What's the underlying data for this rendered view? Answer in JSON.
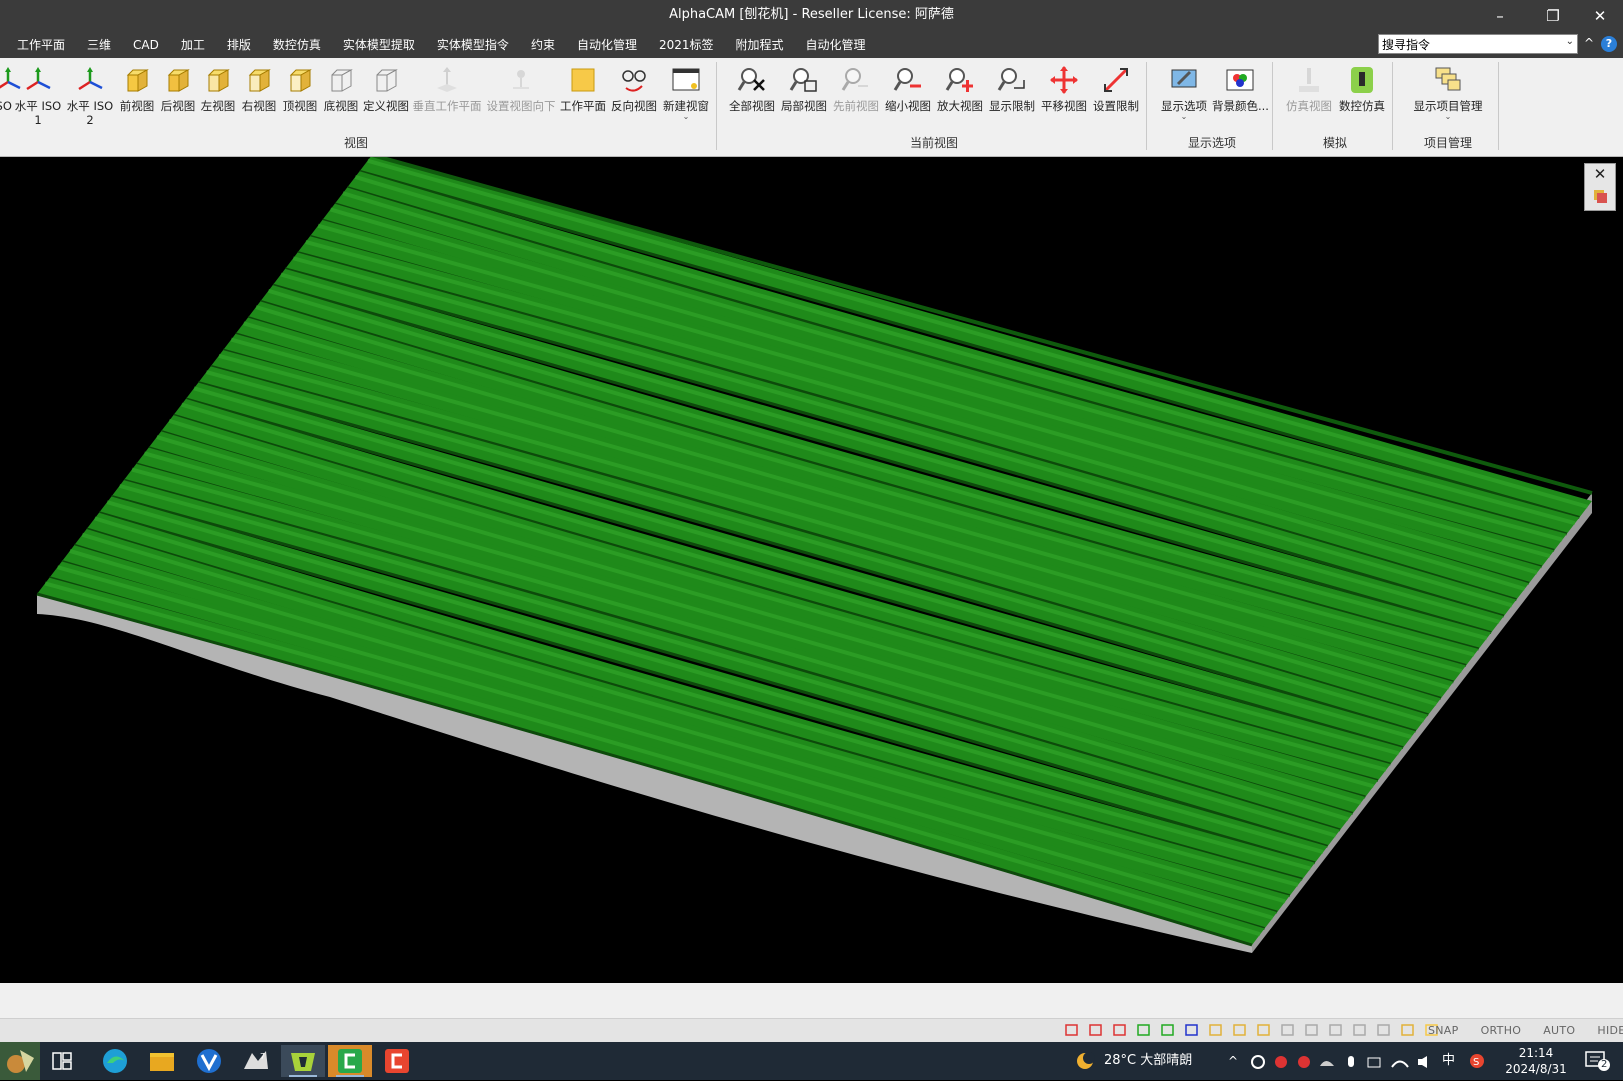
{
  "window": {
    "title": "AlphaCAM [刨花机] - Reseller License: 阿萨德",
    "minimize_icon": "minimize-icon",
    "restore_icon": "restore-icon",
    "close_icon": "close-icon",
    "min_glyph": "–",
    "restore_glyph": "❐",
    "close_glyph": "✕"
  },
  "menu": {
    "items": [
      "工作平面",
      "三维",
      "CAD",
      "加工",
      "排版",
      "数控仿真",
      "实体模型提取",
      "实体模型指令",
      "约束",
      "自动化管理",
      "2021标签",
      "附加程式",
      "自动化管理"
    ]
  },
  "search": {
    "value": "搜寻指令",
    "dropdown_glyph": "⌄"
  },
  "menu_controls": {
    "collapse_glyph": "^",
    "help_glyph": "?"
  },
  "ribbon": {
    "groups": [
      {
        "label": "视图",
        "buttons": [
          {
            "label": "ISO",
            "icon": "iso-axes-icon",
            "enabled": true
          },
          {
            "label": "水平 ISO",
            "label2": "1",
            "icon": "iso-axes-icon",
            "enabled": true
          },
          {
            "label": "水平 ISO",
            "label2": "2",
            "icon": "iso-axes-icon",
            "enabled": true
          },
          {
            "label": "前视图",
            "icon": "cube-front-icon",
            "enabled": true
          },
          {
            "label": "后视图",
            "icon": "cube-back-icon",
            "enabled": true
          },
          {
            "label": "左视图",
            "icon": "cube-left-icon",
            "enabled": true
          },
          {
            "label": "右视图",
            "icon": "cube-right-icon",
            "enabled": true
          },
          {
            "label": "顶视图",
            "icon": "cube-top-icon",
            "enabled": true
          },
          {
            "label": "底视图",
            "icon": "cube-bottom-icon",
            "enabled": true
          },
          {
            "label": "定义视图",
            "icon": "cube-define-icon",
            "enabled": true
          },
          {
            "label": "垂直工作平面",
            "icon": "perpendicular-plane-icon",
            "enabled": false
          },
          {
            "label": "设置视图向下",
            "icon": "view-down-icon",
            "enabled": false
          },
          {
            "label": "工作平面",
            "icon": "work-plane-icon",
            "enabled": true
          },
          {
            "label": "反向视图",
            "icon": "reverse-view-icon",
            "enabled": true
          },
          {
            "label": "新建视窗",
            "icon": "new-window-icon",
            "enabled": true,
            "dropdown": "⌄"
          }
        ]
      },
      {
        "label": "当前视图",
        "buttons": [
          {
            "label": "全部视图",
            "icon": "zoom-all-icon",
            "enabled": true
          },
          {
            "label": "局部视图",
            "icon": "zoom-window-icon",
            "enabled": true
          },
          {
            "label": "先前视图",
            "icon": "zoom-previous-icon",
            "enabled": false
          },
          {
            "label": "缩小视图",
            "icon": "zoom-out-icon",
            "enabled": true
          },
          {
            "label": "放大视图",
            "icon": "zoom-in-icon",
            "enabled": true
          },
          {
            "label": "显示限制",
            "icon": "zoom-extents-icon",
            "enabled": true
          },
          {
            "label": "平移视图",
            "icon": "pan-icon",
            "enabled": true
          },
          {
            "label": "设置限制",
            "icon": "set-limits-icon",
            "enabled": true
          }
        ]
      },
      {
        "label": "显示选项",
        "buttons": [
          {
            "label": "显示选项",
            "icon": "display-options-icon",
            "enabled": true,
            "dropdown": "⌄"
          },
          {
            "label": "背景颜色...",
            "icon": "background-color-icon",
            "enabled": true
          }
        ]
      },
      {
        "label": "模拟",
        "buttons": [
          {
            "label": "仿真视图",
            "icon": "simulation-view-icon",
            "enabled": false
          },
          {
            "label": "数控仿真",
            "icon": "cnc-simulation-icon",
            "enabled": true
          }
        ]
      },
      {
        "label": "项目管理",
        "buttons": [
          {
            "label": "显示项目管理",
            "icon": "project-manager-icon",
            "enabled": true,
            "dropdown": "⌄"
          }
        ]
      }
    ]
  },
  "viewport": {
    "surface_color": "#1f8a1a",
    "base_color": "#b4b4b4",
    "close_glyph": "✕"
  },
  "status": {
    "modes": [
      "SNAP",
      "ORTHO",
      "AUTO",
      "HIDE"
    ]
  },
  "taskbar": {
    "weather": "28°C 大部晴朗",
    "ime": "中",
    "time": "21:14",
    "date": "2024/8/31",
    "notification_count": "2"
  }
}
